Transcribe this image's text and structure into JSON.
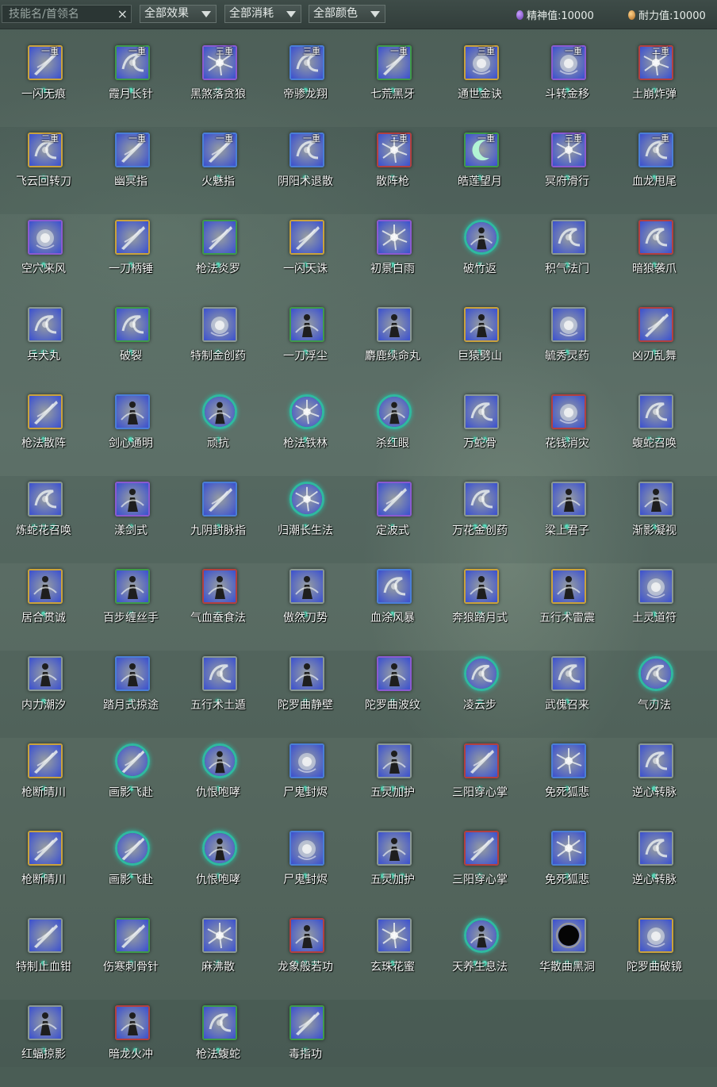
{
  "toolbar": {
    "search_placeholder": "技能名/首领名",
    "clear_icon": "×",
    "filter_effect": "全部效果",
    "filter_cost": "全部消耗",
    "filter_color": "全部颜色",
    "spirit_label": "精神值:",
    "spirit_value": "10000",
    "stamina_label": "耐力值:",
    "stamina_value": "10000"
  },
  "colors": {
    "gold": "#c9a23c",
    "purple": "#8a5ad0",
    "blue": "#4a7ed6",
    "green": "#3f9a4a",
    "red": "#b24040",
    "gray": "#8a9894",
    "teal": "#2fb9a0",
    "dot": "#5ee0c0"
  },
  "skills": [
    {
      "name": "一闪无痕",
      "tier": "一重",
      "frame": "gold",
      "shape": "square",
      "dots": 1,
      "art": "slash",
      "tone": "#3a50d0"
    },
    {
      "name": "霞月长针",
      "tier": "一重",
      "frame": "green",
      "shape": "square",
      "dots": 1,
      "art": "swirl",
      "tone": "#1f9c8c"
    },
    {
      "name": "黑煞落贪狼",
      "tier": "三重",
      "frame": "purple",
      "shape": "square",
      "dots": 1,
      "art": "burst",
      "tone": "#7a3ad0"
    },
    {
      "name": "帝骖龙翔",
      "tier": "三重",
      "frame": "blue",
      "shape": "square",
      "dots": 1,
      "art": "swirl",
      "tone": "#2a6ad8"
    },
    {
      "name": "七荒黑牙",
      "tier": "一重",
      "frame": "green",
      "shape": "square",
      "dots": 1,
      "art": "slash",
      "tone": "#3a3ab0"
    },
    {
      "name": "通世金诀",
      "tier": "三重",
      "frame": "gold",
      "shape": "square",
      "dots": 1,
      "art": "orb",
      "tone": "#b09030"
    },
    {
      "name": "斗转金移",
      "tier": "一重",
      "frame": "purple",
      "shape": "square",
      "dots": 1,
      "art": "orb",
      "tone": "#c08a20"
    },
    {
      "name": "土崩炸弹",
      "tier": "二重",
      "frame": "red",
      "shape": "square",
      "dots": 1,
      "art": "burst",
      "tone": "#d07a20"
    },
    {
      "name": "飞云回转刀",
      "tier": "二重",
      "frame": "gold",
      "shape": "square",
      "dots": 1,
      "art": "swirl",
      "tone": "#6a4ad0"
    },
    {
      "name": "幽冥指",
      "tier": "一重",
      "frame": "blue",
      "shape": "square",
      "dots": 1,
      "art": "slash",
      "tone": "#2a80d8"
    },
    {
      "name": "火魅指",
      "tier": "一重",
      "frame": "blue",
      "shape": "square",
      "dots": 1,
      "art": "slash",
      "tone": "#c05020"
    },
    {
      "name": "阴阳术退散",
      "tier": "一重",
      "frame": "blue",
      "shape": "square",
      "dots": 1,
      "art": "swirl",
      "tone": "#2a90c8"
    },
    {
      "name": "散阵枪",
      "tier": "二重",
      "frame": "red",
      "shape": "square",
      "dots": 1,
      "art": "burst",
      "tone": "#c06020"
    },
    {
      "name": "皓莲望月",
      "tier": "一重",
      "frame": "green",
      "shape": "square",
      "dots": 1,
      "art": "moon",
      "tone": "#1a8a70"
    },
    {
      "name": "冥府滑行",
      "tier": "三重",
      "frame": "purple",
      "shape": "square",
      "dots": 1,
      "art": "burst",
      "tone": "#a02030"
    },
    {
      "name": "血龙甩尾",
      "tier": "一重",
      "frame": "blue",
      "shape": "square",
      "dots": 1,
      "art": "swirl",
      "tone": "#1a8aa0"
    },
    {
      "name": "空穴来风",
      "tier": "",
      "frame": "purple",
      "shape": "square",
      "dots": 1,
      "art": "orb",
      "tone": "#6a6a6a"
    },
    {
      "name": "一刀柄锤",
      "tier": "",
      "frame": "gold",
      "shape": "square",
      "dots": 1,
      "art": "slash",
      "tone": "#6a6a6a"
    },
    {
      "name": "枪法炎罗",
      "tier": "",
      "frame": "green",
      "shape": "square",
      "dots": 1,
      "art": "slash",
      "tone": "#5a5a5a"
    },
    {
      "name": "一闪天诛",
      "tier": "",
      "frame": "gold",
      "shape": "square",
      "dots": 1,
      "art": "slash",
      "tone": "#6a6a6a"
    },
    {
      "name": "初景白雨",
      "tier": "",
      "frame": "purple",
      "shape": "square",
      "dots": 1,
      "art": "burst",
      "tone": "#6a6a6a"
    },
    {
      "name": "破竹返",
      "tier": "",
      "frame": "teal",
      "shape": "round",
      "dots": 1,
      "art": "figure",
      "tone": "#4a4a4a"
    },
    {
      "name": "积气法门",
      "tier": "",
      "frame": "gray",
      "shape": "square",
      "dots": 1,
      "art": "swirl",
      "tone": "#5a5a5a"
    },
    {
      "name": "暗狼袭爪",
      "tier": "",
      "frame": "red",
      "shape": "square",
      "dots": 1,
      "art": "swirl",
      "tone": "#5a5a5a"
    },
    {
      "name": "兵犬丸",
      "tier": "",
      "frame": "gray",
      "shape": "square",
      "dots": 3,
      "art": "swirl",
      "tone": "#555555"
    },
    {
      "name": "破裂",
      "tier": "",
      "frame": "green",
      "shape": "square",
      "dots": 1,
      "art": "swirl",
      "tone": "#555555"
    },
    {
      "name": "特制金创药",
      "tier": "",
      "frame": "gray",
      "shape": "square",
      "dots": 1,
      "art": "orb",
      "tone": "#555555"
    },
    {
      "name": "一刀浮尘",
      "tier": "",
      "frame": "green",
      "shape": "square",
      "dots": 1,
      "art": "figure",
      "tone": "#555555"
    },
    {
      "name": "麝鹿续命丸",
      "tier": "",
      "frame": "gray",
      "shape": "square",
      "dots": 1,
      "art": "figure",
      "tone": "#444444"
    },
    {
      "name": "巨猿劈山",
      "tier": "",
      "frame": "gold",
      "shape": "square",
      "dots": 1,
      "art": "figure",
      "tone": "#555555"
    },
    {
      "name": "毓秀灵药",
      "tier": "",
      "frame": "gray",
      "shape": "square",
      "dots": 1,
      "art": "orb",
      "tone": "#555555"
    },
    {
      "name": "凶刃乱舞",
      "tier": "",
      "frame": "red",
      "shape": "square",
      "dots": 1,
      "art": "slash",
      "tone": "#444444"
    },
    {
      "name": "枪法散阵",
      "tier": "",
      "frame": "gold",
      "shape": "square",
      "dots": 1,
      "art": "slash",
      "tone": "#555555"
    },
    {
      "name": "剑心通明",
      "tier": "",
      "frame": "blue",
      "shape": "square",
      "dots": 1,
      "art": "figure",
      "tone": "#555555"
    },
    {
      "name": "顽抗",
      "tier": "",
      "frame": "teal",
      "shape": "round",
      "dots": 1,
      "art": "figure",
      "tone": "#444444"
    },
    {
      "name": "枪法铁林",
      "tier": "",
      "frame": "teal",
      "shape": "round",
      "dots": 1,
      "art": "burst",
      "tone": "#444444"
    },
    {
      "name": "杀红眼",
      "tier": "",
      "frame": "teal",
      "shape": "round",
      "dots": 1,
      "art": "figure",
      "tone": "#3a3a3a"
    },
    {
      "name": "万蛇骨",
      "tier": "",
      "frame": "gray",
      "shape": "square",
      "dots": 2,
      "art": "swirl",
      "tone": "#555555"
    },
    {
      "name": "花钱消灾",
      "tier": "",
      "frame": "red",
      "shape": "square",
      "dots": 1,
      "art": "orb",
      "tone": "#555555"
    },
    {
      "name": "蝮蛇召唤",
      "tier": "",
      "frame": "gray",
      "shape": "square",
      "dots": 2,
      "art": "swirl",
      "tone": "#555555"
    },
    {
      "name": "炼蛇花召唤",
      "tier": "",
      "frame": "gray",
      "shape": "square",
      "dots": 3,
      "art": "swirl",
      "tone": "#555555"
    },
    {
      "name": "漾剑式",
      "tier": "",
      "frame": "purple",
      "shape": "square",
      "dots": 1,
      "art": "figure",
      "tone": "#555555"
    },
    {
      "name": "九阴封脉指",
      "tier": "",
      "frame": "blue",
      "shape": "square",
      "dots": 1,
      "art": "slash",
      "tone": "#555555"
    },
    {
      "name": "归潮长生法",
      "tier": "",
      "frame": "teal",
      "shape": "round",
      "dots": 1,
      "art": "burst",
      "tone": "#444444"
    },
    {
      "name": "定波式",
      "tier": "",
      "frame": "purple",
      "shape": "square",
      "dots": 1,
      "art": "slash",
      "tone": "#555555"
    },
    {
      "name": "万花金创药",
      "tier": "",
      "frame": "gray",
      "shape": "square",
      "dots": 2,
      "art": "swirl",
      "tone": "#555555"
    },
    {
      "name": "梁上君子",
      "tier": "",
      "frame": "gray",
      "shape": "square",
      "dots": 1,
      "art": "figure",
      "tone": "#555555"
    },
    {
      "name": "渐影凝视",
      "tier": "",
      "frame": "gray",
      "shape": "square",
      "dots": 1,
      "art": "figure",
      "tone": "#3a3a3a"
    },
    {
      "name": "居合贯诚",
      "tier": "",
      "frame": "gold",
      "shape": "square",
      "dots": 1,
      "art": "figure",
      "tone": "#555555"
    },
    {
      "name": "百步缠丝手",
      "tier": "",
      "frame": "green",
      "shape": "square",
      "dots": 1,
      "art": "figure",
      "tone": "#555555"
    },
    {
      "name": "气血蚕食法",
      "tier": "",
      "frame": "red",
      "shape": "square",
      "dots": 1,
      "art": "figure",
      "tone": "#444444"
    },
    {
      "name": "傲然刀势",
      "tier": "",
      "frame": "gray",
      "shape": "square",
      "dots": 1,
      "art": "figure",
      "tone": "#444444"
    },
    {
      "name": "血涂风暴",
      "tier": "",
      "frame": "blue",
      "shape": "square",
      "dots": 1,
      "art": "swirl",
      "tone": "#555555"
    },
    {
      "name": "奔狼踏月式",
      "tier": "",
      "frame": "gold",
      "shape": "square",
      "dots": 1,
      "art": "figure",
      "tone": "#555555"
    },
    {
      "name": "五行术雷震",
      "tier": "",
      "frame": "gold",
      "shape": "square",
      "dots": 1,
      "art": "figure",
      "tone": "#444444"
    },
    {
      "name": "土灵道符",
      "tier": "",
      "frame": "gray",
      "shape": "square",
      "dots": 1,
      "art": "orb",
      "tone": "#666666"
    },
    {
      "name": "内力潮汐",
      "tier": "",
      "frame": "gray",
      "shape": "square",
      "dots": 1,
      "art": "figure",
      "tone": "#444444"
    },
    {
      "name": "踏月式掠途",
      "tier": "",
      "frame": "blue",
      "shape": "square",
      "dots": 1,
      "art": "figure",
      "tone": "#444444"
    },
    {
      "name": "五行术土遁",
      "tier": "",
      "frame": "gray",
      "shape": "square",
      "dots": 1,
      "art": "swirl",
      "tone": "#444444"
    },
    {
      "name": "陀罗曲静壁",
      "tier": "",
      "frame": "gray",
      "shape": "square",
      "dots": 1,
      "art": "figure",
      "tone": "#555555"
    },
    {
      "name": "陀罗曲波纹",
      "tier": "",
      "frame": "purple",
      "shape": "square",
      "dots": 1,
      "art": "figure",
      "tone": "#555555"
    },
    {
      "name": "凌云步",
      "tier": "",
      "frame": "teal",
      "shape": "round",
      "dots": 1,
      "art": "swirl",
      "tone": "#444444"
    },
    {
      "name": "武傀召来",
      "tier": "",
      "frame": "gray",
      "shape": "square",
      "dots": 1,
      "art": "swirl",
      "tone": "#555555"
    },
    {
      "name": "气刃法",
      "tier": "",
      "frame": "teal",
      "shape": "round",
      "dots": 1,
      "art": "swirl",
      "tone": "#555555"
    },
    {
      "name": "枪断晴川",
      "tier": "",
      "frame": "gold",
      "shape": "square",
      "dots": 1,
      "art": "slash",
      "tone": "#555555"
    },
    {
      "name": "画影飞赴",
      "tier": "",
      "frame": "teal",
      "shape": "round",
      "dots": 1,
      "art": "slash",
      "tone": "#444444"
    },
    {
      "name": "仇恨咆哮",
      "tier": "",
      "frame": "teal",
      "shape": "round",
      "dots": 1,
      "art": "figure",
      "tone": "#444444"
    },
    {
      "name": "尸鬼封烬",
      "tier": "",
      "frame": "blue",
      "shape": "square",
      "dots": 1,
      "art": "orb",
      "tone": "#555555"
    },
    {
      "name": "五灵加护",
      "tier": "",
      "frame": "gray",
      "shape": "square",
      "dots": 3,
      "art": "figure",
      "tone": "#444444"
    },
    {
      "name": "三阳穿心掌",
      "tier": "",
      "frame": "red",
      "shape": "square",
      "dots": 1,
      "art": "slash",
      "tone": "#444444"
    },
    {
      "name": "免死狐悲",
      "tier": "",
      "frame": "blue",
      "shape": "square",
      "dots": 1,
      "art": "burst",
      "tone": "#444444"
    },
    {
      "name": "逆心转脉",
      "tier": "",
      "frame": "gray",
      "shape": "square",
      "dots": 1,
      "art": "swirl",
      "tone": "#444444"
    },
    {
      "name": "枪断晴川",
      "tier": "",
      "frame": "gold",
      "shape": "square",
      "dots": 1,
      "art": "slash",
      "tone": "#555555"
    },
    {
      "name": "画影飞赴",
      "tier": "",
      "frame": "teal",
      "shape": "round",
      "dots": 1,
      "art": "slash",
      "tone": "#444444"
    },
    {
      "name": "仇恨咆哮",
      "tier": "",
      "frame": "teal",
      "shape": "round",
      "dots": 1,
      "art": "figure",
      "tone": "#444444"
    },
    {
      "name": "尸鬼封烬",
      "tier": "",
      "frame": "blue",
      "shape": "square",
      "dots": 1,
      "art": "orb",
      "tone": "#555555"
    },
    {
      "name": "五灵加护",
      "tier": "",
      "frame": "gray",
      "shape": "square",
      "dots": 3,
      "art": "figure",
      "tone": "#444444"
    },
    {
      "name": "三阳穿心掌",
      "tier": "",
      "frame": "red",
      "shape": "square",
      "dots": 1,
      "art": "slash",
      "tone": "#444444"
    },
    {
      "name": "免死狐悲",
      "tier": "",
      "frame": "blue",
      "shape": "square",
      "dots": 1,
      "art": "burst",
      "tone": "#444444"
    },
    {
      "name": "逆心转脉",
      "tier": "",
      "frame": "gray",
      "shape": "square",
      "dots": 1,
      "art": "swirl",
      "tone": "#444444"
    },
    {
      "name": "特制止血钳",
      "tier": "",
      "frame": "gray",
      "shape": "square",
      "dots": 1,
      "art": "slash",
      "tone": "#555555"
    },
    {
      "name": "伤寒刺骨针",
      "tier": "",
      "frame": "green",
      "shape": "square",
      "dots": 1,
      "art": "slash",
      "tone": "#555555"
    },
    {
      "name": "麻沸散",
      "tier": "",
      "frame": "gray",
      "shape": "square",
      "dots": 1,
      "art": "burst",
      "tone": "#666666"
    },
    {
      "name": "龙象般若功",
      "tier": "",
      "frame": "red",
      "shape": "square",
      "dots": 3,
      "art": "figure",
      "tone": "#555555"
    },
    {
      "name": "玄珠花蜜",
      "tier": "",
      "frame": "gray",
      "shape": "square",
      "dots": 1,
      "art": "burst",
      "tone": "#555555"
    },
    {
      "name": "天养生息法",
      "tier": "",
      "frame": "teal",
      "shape": "round",
      "dots": 2,
      "art": "figure",
      "tone": "#444444"
    },
    {
      "name": "华散曲黑洞",
      "tier": "",
      "frame": "gray",
      "shape": "square",
      "dots": 3,
      "art": "hole",
      "tone": "#222222"
    },
    {
      "name": "陀罗曲破镜",
      "tier": "",
      "frame": "gold",
      "shape": "square",
      "dots": 1,
      "art": "orb",
      "tone": "#777777"
    },
    {
      "name": "红蝠掠影",
      "tier": "",
      "frame": "gray",
      "shape": "square",
      "dots": 1,
      "art": "figure",
      "tone": "#444444"
    },
    {
      "name": "暗龙火冲",
      "tier": "",
      "frame": "red",
      "shape": "square",
      "dots": 2,
      "art": "figure",
      "tone": "#555555"
    },
    {
      "name": "枪法蝮蛇",
      "tier": "",
      "frame": "green",
      "shape": "square",
      "dots": 1,
      "art": "swirl",
      "tone": "#555555"
    },
    {
      "name": "毒指功",
      "tier": "",
      "frame": "green",
      "shape": "square",
      "dots": 1,
      "art": "slash",
      "tone": "#555555"
    }
  ]
}
